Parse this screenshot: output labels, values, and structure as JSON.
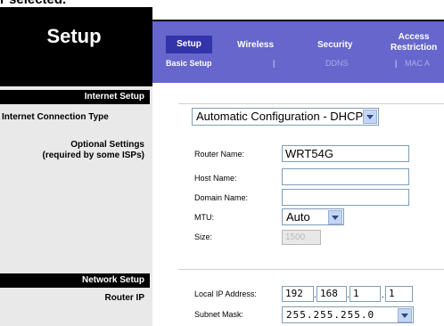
{
  "caption": {
    "text": "r selected."
  },
  "header": {
    "title": "Setup",
    "tabs": [
      {
        "label": "Setup"
      },
      {
        "label": "Wireless"
      },
      {
        "label": "Security"
      },
      {
        "label": "Access Restriction"
      }
    ],
    "subtabs": [
      {
        "label": "Basic Setup"
      },
      {
        "label": "|"
      },
      {
        "label": "DDNS"
      },
      {
        "label": "|"
      },
      {
        "label": "MAC A"
      }
    ]
  },
  "left": {
    "internet_setup_heading": "Internet Setup",
    "internet_connection_type_label": "Internet Connection Type",
    "optional_settings_label_1": "Optional Settings",
    "optional_settings_label_2": "(required by some ISPs)",
    "network_setup_heading": "Network Setup",
    "router_ip_label": "Router IP"
  },
  "form": {
    "connection_type": "Automatic Configuration - DHCP",
    "router_name_label": "Router Name:",
    "router_name_value": "WRT54G",
    "host_name_label": "Host Name:",
    "host_name_value": "",
    "domain_name_label": "Domain Name:",
    "domain_name_value": "",
    "mtu_label": "MTU:",
    "mtu_value": "Auto",
    "size_label": "Size:",
    "size_value": "1500",
    "local_ip_label": "Local IP Address:",
    "local_ip": [
      "192",
      "168",
      "1",
      "1"
    ],
    "ip_dot": ".",
    "subnet_mask_label": "Subnet Mask:",
    "subnet_mask_value": "255.255.255.0"
  },
  "colors": {
    "tab_bar": "#6666cc",
    "active_tab": "#3333aa",
    "left_panel": "#e9e9e9",
    "section_header": "#000000"
  }
}
